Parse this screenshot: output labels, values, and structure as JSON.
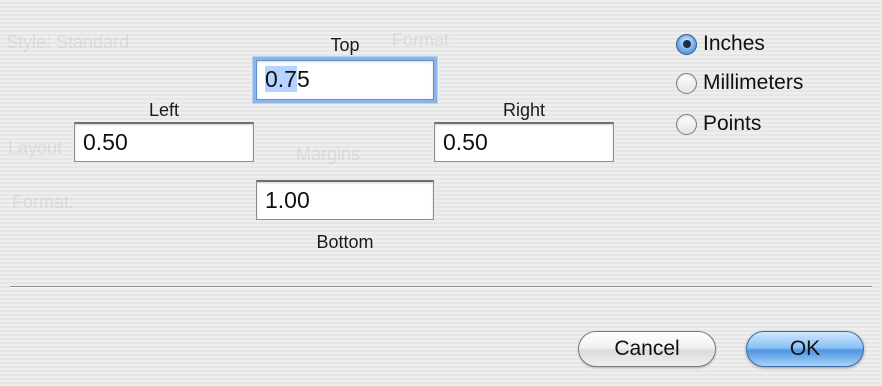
{
  "margins": {
    "top": {
      "label": "Top",
      "value": "0.75",
      "selected_text": "0.7",
      "rest_text": "5"
    },
    "left": {
      "label": "Left",
      "value": "0.50"
    },
    "right": {
      "label": "Right",
      "value": "0.50"
    },
    "bottom": {
      "label": "Bottom",
      "value": "1.00"
    }
  },
  "units": {
    "options": [
      {
        "label": "Inches",
        "selected": true
      },
      {
        "label": "Millimeters",
        "selected": false
      },
      {
        "label": "Points",
        "selected": false
      }
    ]
  },
  "buttons": {
    "cancel_label": "Cancel",
    "ok_label": "OK"
  },
  "colors": {
    "focus_ring": "#8cb4ec",
    "text_selection": "#b5d3ff",
    "default_button": "#4f95e0"
  },
  "background_ghost": {
    "items": [
      "Style: Standard",
      "Format",
      "Layout",
      "Margins",
      "Format:"
    ]
  }
}
